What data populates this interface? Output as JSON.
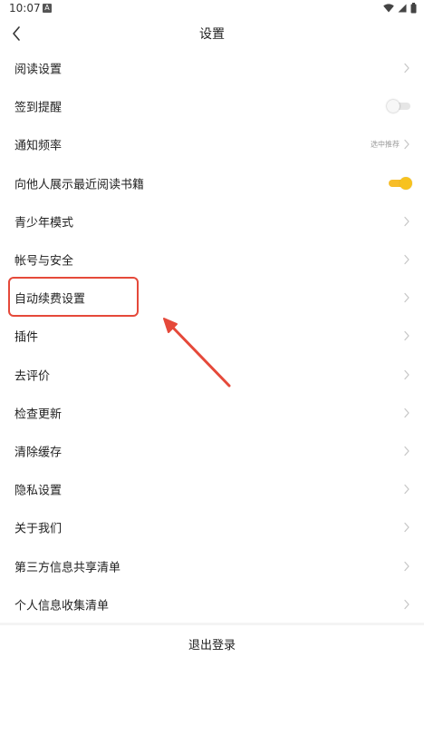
{
  "status_bar": {
    "time": "10:07",
    "notification_badge": "A"
  },
  "header": {
    "title": "设置",
    "back_icon": "chevron-left-icon"
  },
  "settings": {
    "items": [
      {
        "label": "阅读设置",
        "control": "chevron"
      },
      {
        "label": "签到提醒",
        "control": "toggle",
        "toggle_on": false
      },
      {
        "label": "通知频率",
        "control": "chevron",
        "value": "选中推荐"
      },
      {
        "label": "向他人展示最近阅读书籍",
        "control": "toggle",
        "toggle_on": true
      },
      {
        "label": "青少年模式",
        "control": "chevron"
      },
      {
        "label": "帐号与安全",
        "control": "chevron"
      },
      {
        "label": "自动续费设置",
        "control": "chevron",
        "highlighted": true
      },
      {
        "label": "插件",
        "control": "chevron"
      },
      {
        "label": "去评价",
        "control": "chevron"
      },
      {
        "label": "检查更新",
        "control": "chevron"
      },
      {
        "label": "清除缓存",
        "control": "chevron"
      },
      {
        "label": "隐私设置",
        "control": "chevron"
      },
      {
        "label": "关于我们",
        "control": "chevron"
      },
      {
        "label": "第三方信息共享清单",
        "control": "chevron"
      },
      {
        "label": "个人信息收集清单",
        "control": "chevron"
      }
    ]
  },
  "logout": {
    "label": "退出登录"
  },
  "colors": {
    "accent_toggle": "#f7bd2a",
    "annotation": "#e5493a",
    "chevron": "#c8c8c8",
    "secondary_text": "#999999"
  }
}
